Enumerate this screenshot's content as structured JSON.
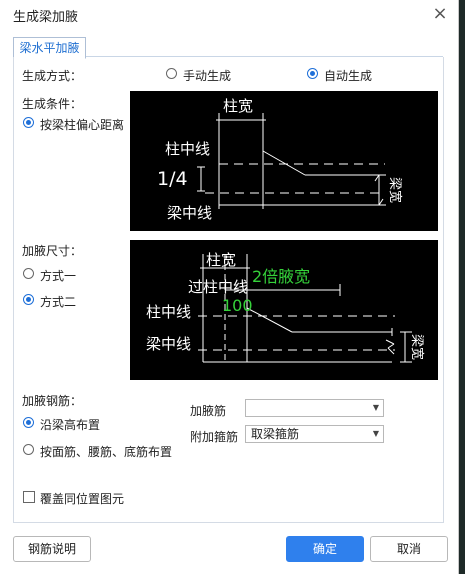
{
  "window": {
    "title": "生成梁加腋",
    "close_glyph": "×"
  },
  "tabs": [
    {
      "label": "梁水平加腋"
    }
  ],
  "gen_method": {
    "label": "生成方式：",
    "options": [
      {
        "label": "手动生成",
        "selected": false
      },
      {
        "label": "自动生成",
        "selected": true
      }
    ]
  },
  "gen_condition": {
    "label": "生成条件：",
    "option": {
      "label": "按梁柱偏心距离",
      "selected": true
    }
  },
  "figure1": {
    "col_width": "柱宽",
    "col_center": "柱中线",
    "fraction": "1/4",
    "beam_center": "梁中线",
    "beam_width": "梁宽"
  },
  "haunch_size": {
    "label": "加腋尺寸：",
    "options": [
      {
        "label": "方式一",
        "selected": false
      },
      {
        "label": "方式二",
        "selected": true
      }
    ]
  },
  "figure2": {
    "col_width": "柱宽",
    "through_col_center": "过柱中线",
    "double_haunch": "2倍腋宽",
    "value": "100",
    "col_center": "柱中线",
    "beam_center": "梁中线",
    "beam_width": "梁宽"
  },
  "haunch_rebar": {
    "label": "加腋钢筋：",
    "options": [
      {
        "label": "沿梁高布置",
        "selected": true
      },
      {
        "label": "按面筋、腰筋、底筋布置",
        "selected": false
      }
    ],
    "fields": [
      {
        "label": "加腋筋",
        "value": ""
      },
      {
        "label": "附加箍筋",
        "value": "取梁箍筋"
      }
    ]
  },
  "overwrite": {
    "label": "覆盖同位置图元",
    "checked": false
  },
  "buttons": {
    "help": "钢筋说明",
    "ok": "确定",
    "cancel": "取消"
  },
  "colors": {
    "accent": "#2f80ed",
    "highlight_text": "#35d23a"
  }
}
